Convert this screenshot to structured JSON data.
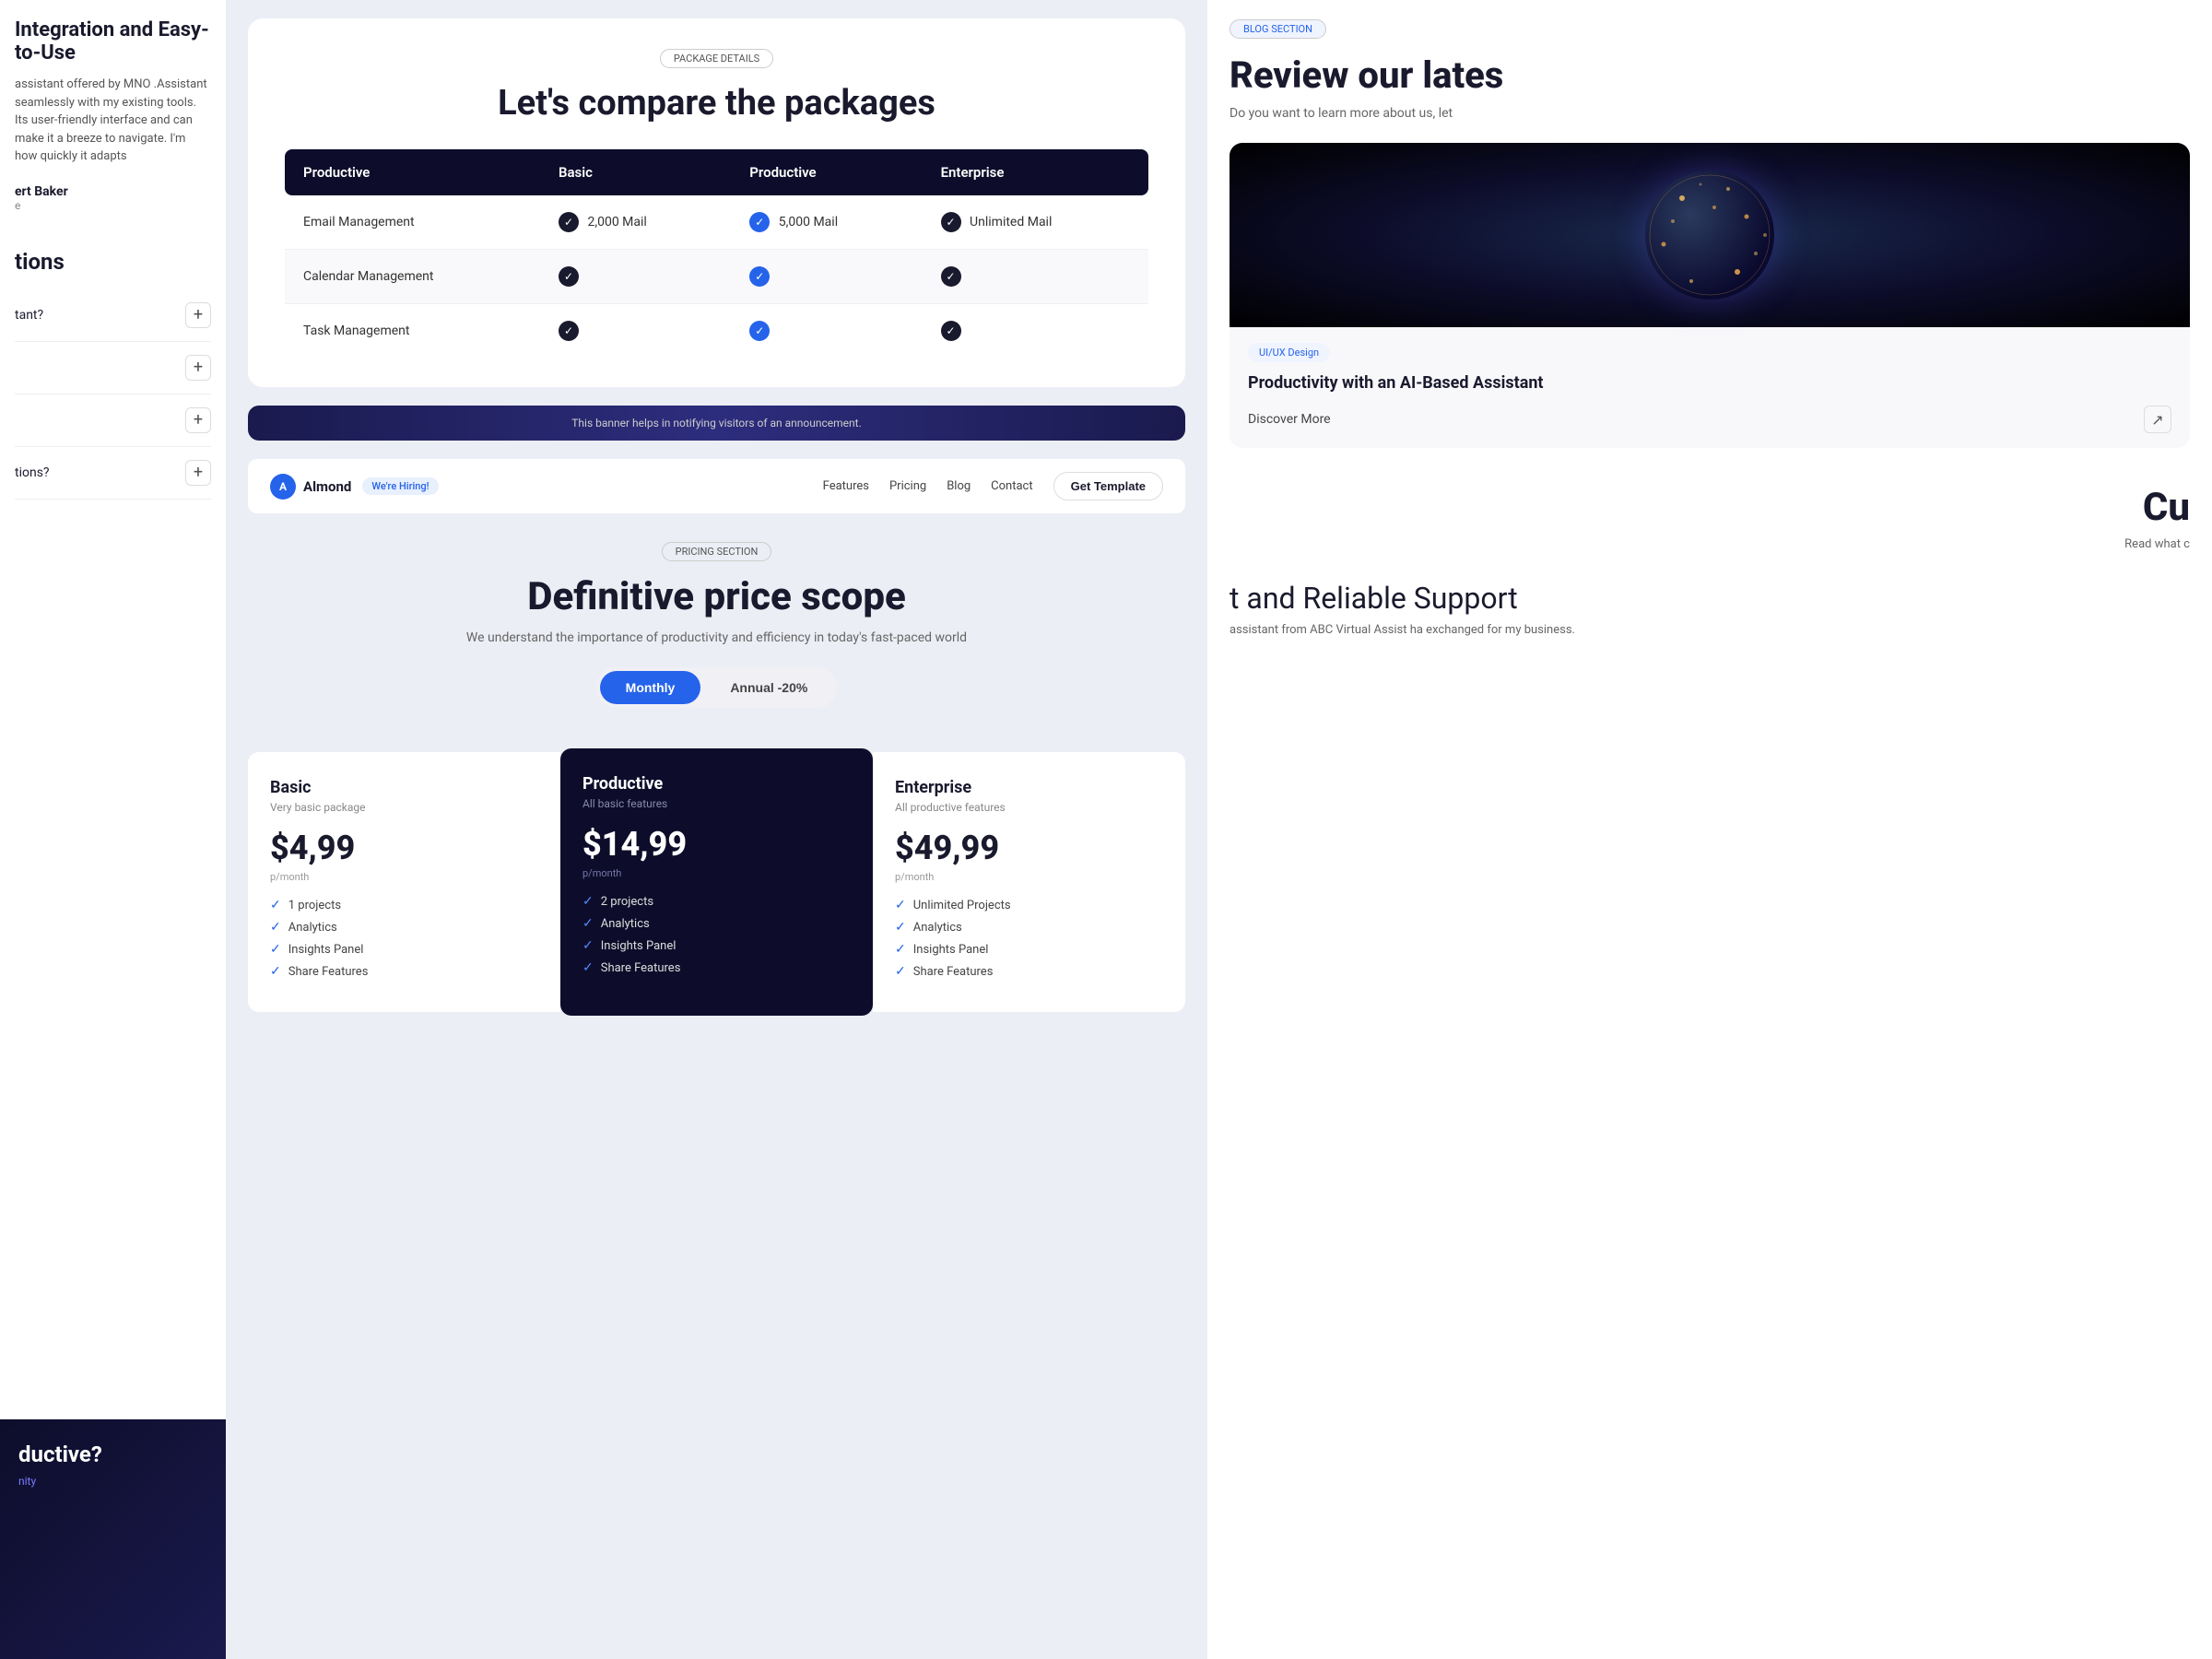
{
  "leftPanel": {
    "sectionTitle": "Integration and Easy-to-Use",
    "reviewText": "assistant offered by MNO .Assistant seamlessly with my existing tools. Its user-friendly interface and can make it a breeze to navigate. I'm how quickly it adapts",
    "reviewerName": "ert Baker",
    "reviewerRole": "e",
    "faqTitle": "tions",
    "faqItems": [
      {
        "question": "tant?",
        "id": "faq-1"
      },
      {
        "question": "",
        "id": "faq-2"
      },
      {
        "question": "tions?",
        "id": "faq-3"
      }
    ],
    "darkCard": {
      "title": "ductive?",
      "subtitle": "nity"
    }
  },
  "centerPanel": {
    "packageSection": {
      "tag": "PACKAGE DETAILS",
      "title": "Let's compare the packages",
      "tableHeaders": [
        "Productive",
        "Basic",
        "Productive",
        "Enterprise"
      ],
      "rows": [
        {
          "feature": "Email Management",
          "basic": "2,000 Mail",
          "productive": "5,000 Mail",
          "enterprise": "Unlimited Mail",
          "basicCheck": "dark",
          "productiveCheck": "blue",
          "enterpriseCheck": "dark"
        },
        {
          "feature": "Calendar Management",
          "basicCheck": "dark",
          "productiveCheck": "blue",
          "enterpriseCheck": "dark"
        },
        {
          "feature": "Task Management",
          "basicCheck": "dark",
          "productiveCheck": "blue",
          "enterpriseCheck": "dark"
        }
      ]
    },
    "banner": {
      "text": "This banner helps in notifying visitors of an announcement."
    },
    "navbar": {
      "logo": "Almond",
      "hiringBadge": "We're Hiring!",
      "links": [
        "Features",
        "Pricing",
        "Blog",
        "Contact"
      ],
      "ctaButton": "Get Template"
    },
    "pricingSection": {
      "tag": "PRICING SECTION",
      "title": "Definitive price scope",
      "subtitle": "We understand the importance of productivity and efficiency in today's fast-paced world",
      "billingOptions": [
        {
          "label": "Monthly",
          "active": true
        },
        {
          "label": "Annual -20%",
          "active": false
        }
      ],
      "plans": [
        {
          "name": "Basic",
          "desc": "Very basic package",
          "price": "$4,99",
          "perMonth": "p/month",
          "featured": false,
          "features": [
            "1 projects",
            "Analytics",
            "Insights Panel",
            "Share Features"
          ]
        },
        {
          "name": "Productive",
          "desc": "All basic features",
          "price": "$14,99",
          "perMonth": "p/month",
          "featured": true,
          "features": [
            "2 projects",
            "Analytics",
            "Insights Panel",
            "Share Features"
          ]
        },
        {
          "name": "Enterprise",
          "desc": "All productive features",
          "price": "$49,99",
          "perMonth": "p/month",
          "featured": false,
          "features": [
            "Unlimited Projects",
            "Analytics",
            "Insights Panel",
            "Share Features"
          ]
        }
      ]
    }
  },
  "rightPanel": {
    "blogTag": "BLOG SECTION",
    "blogTitle": "Review our lates",
    "blogSubtitle": "Do you want to learn more about us, let",
    "blogCard": {
      "uiTag": "UI/UX Design",
      "title": "Productivity with an AI-Based Assistant",
      "discoverMore": "Discover More"
    },
    "sectionTitleRight": "Cu",
    "readWhat": "Read what c",
    "reliableTitle": "t and Reliable Support",
    "reliableSub": "assistant from ABC Virtual Assist ha exchanged for my business."
  }
}
